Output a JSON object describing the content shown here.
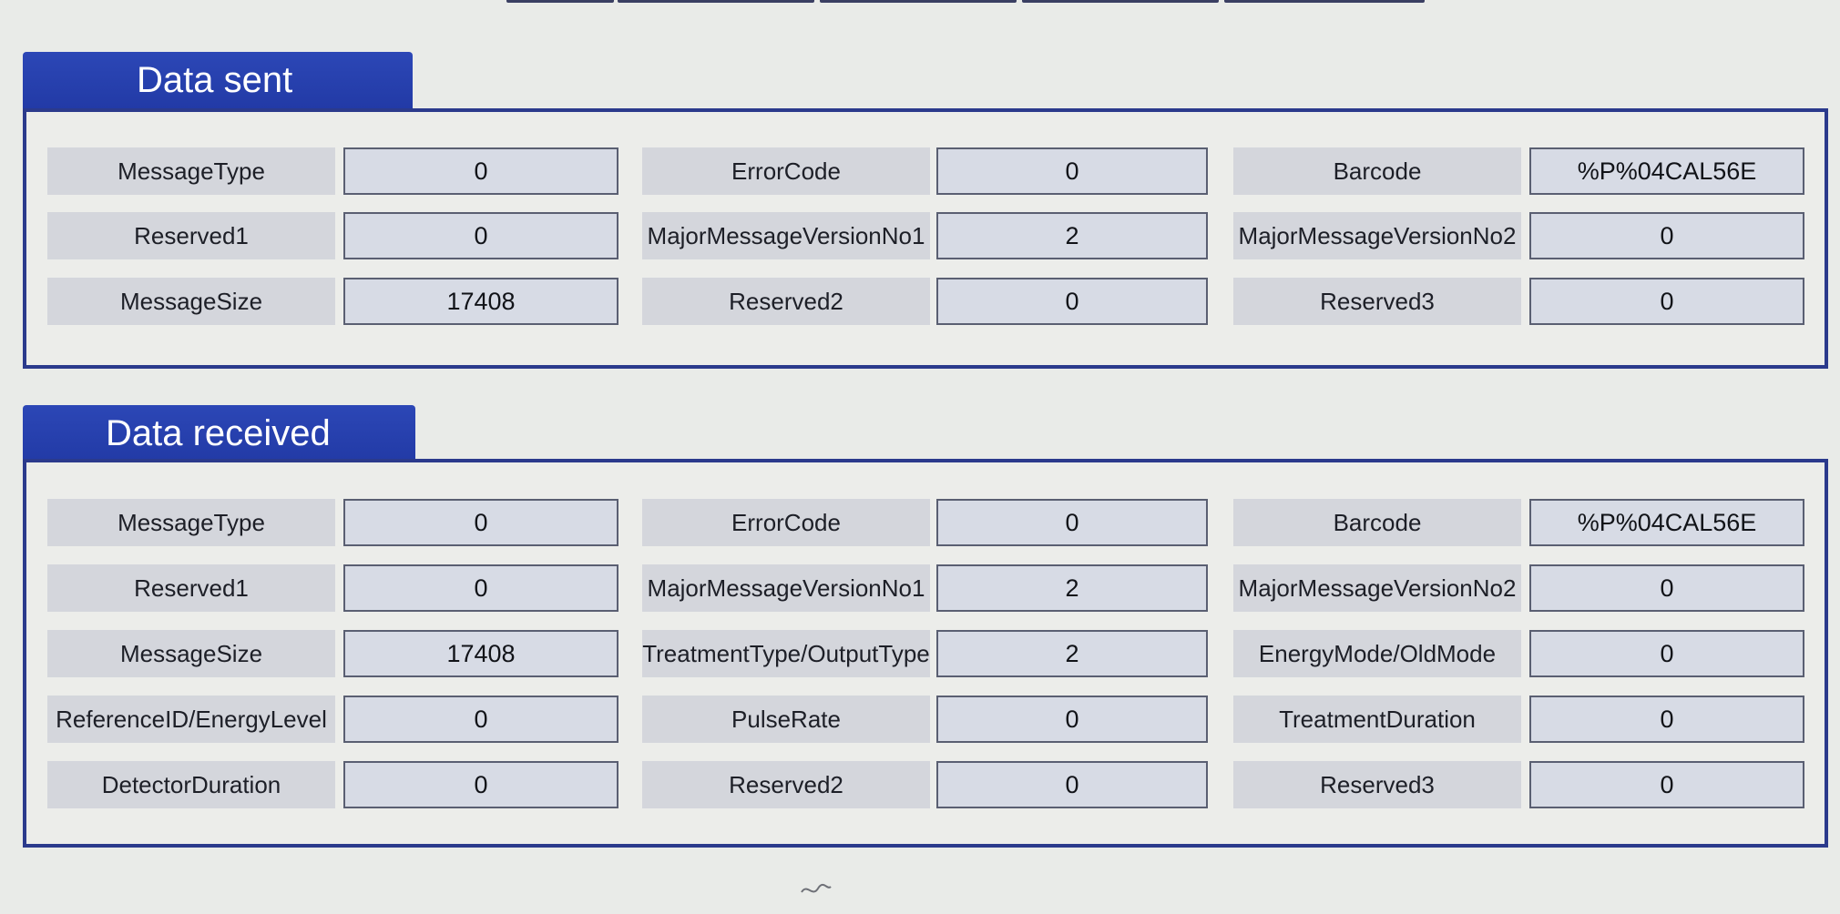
{
  "sent": {
    "title": "Data sent",
    "rows": [
      [
        {
          "label": "MessageType",
          "value": "0"
        },
        {
          "label": "ErrorCode",
          "value": "0"
        },
        {
          "label": "Barcode",
          "value": "%P%04CAL56E"
        }
      ],
      [
        {
          "label": "Reserved1",
          "value": "0"
        },
        {
          "label": "MajorMessageVersionNo1",
          "value": "2"
        },
        {
          "label": "MajorMessageVersionNo2",
          "value": "0"
        }
      ],
      [
        {
          "label": "MessageSize",
          "value": "17408"
        },
        {
          "label": "Reserved2",
          "value": "0"
        },
        {
          "label": "Reserved3",
          "value": "0"
        }
      ]
    ]
  },
  "received": {
    "title": "Data received",
    "rows": [
      [
        {
          "label": "MessageType",
          "value": "0"
        },
        {
          "label": "ErrorCode",
          "value": "0"
        },
        {
          "label": "Barcode",
          "value": "%P%04CAL56E"
        }
      ],
      [
        {
          "label": "Reserved1",
          "value": "0"
        },
        {
          "label": "MajorMessageVersionNo1",
          "value": "2"
        },
        {
          "label": "MajorMessageVersionNo2",
          "value": "0"
        }
      ],
      [
        {
          "label": "MessageSize",
          "value": "17408"
        },
        {
          "label": "TreatmentType/OutputType",
          "value": "2"
        },
        {
          "label": "EnergyMode/OldMode",
          "value": "0"
        }
      ],
      [
        {
          "label": "ReferenceID/EnergyLevel",
          "value": "0"
        },
        {
          "label": "PulseRate",
          "value": "0"
        },
        {
          "label": "TreatmentDuration",
          "value": "0"
        }
      ],
      [
        {
          "label": "DetectorDuration",
          "value": "0"
        },
        {
          "label": "Reserved2",
          "value": "0"
        },
        {
          "label": "Reserved3",
          "value": "0"
        }
      ]
    ]
  },
  "colors": {
    "tab_blue": "#223aa6",
    "panel_border": "#2b3a8c",
    "label_bg": "#d4d6dc",
    "value_bg": "#d7dbe5"
  }
}
